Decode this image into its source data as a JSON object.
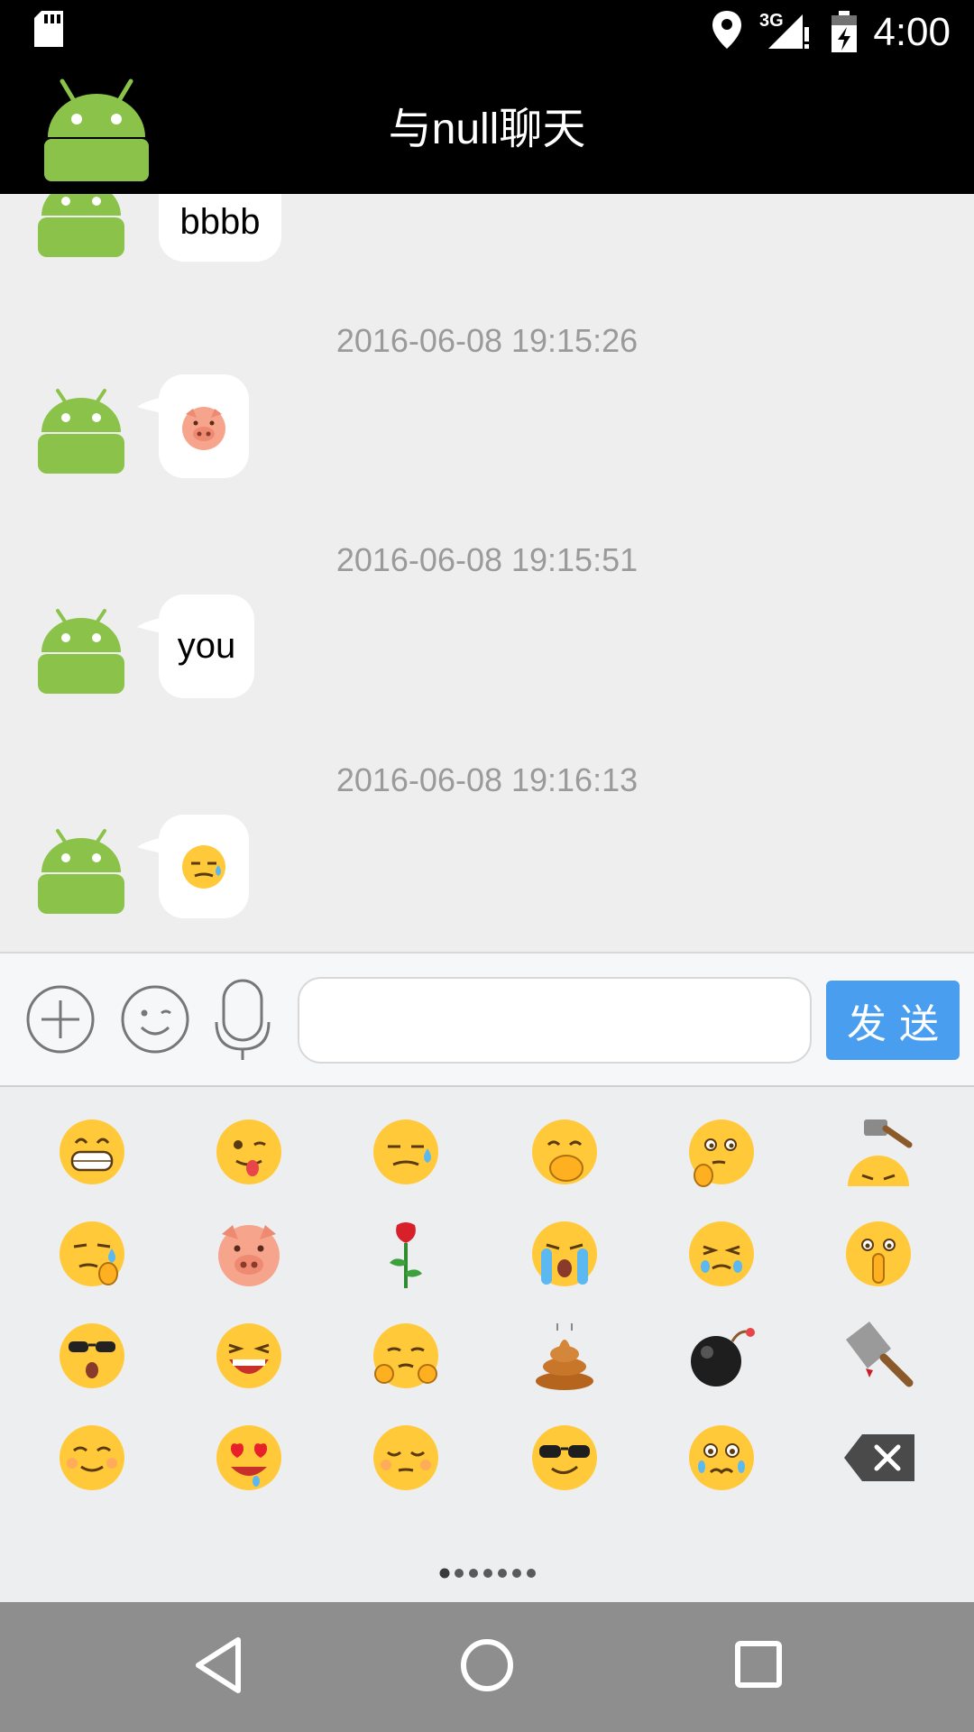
{
  "status_bar": {
    "time": "4:00",
    "network": "3G"
  },
  "app_bar": {
    "title": "与null聊天"
  },
  "messages": [
    {
      "timestamp": "",
      "type": "text",
      "content": "bbbb"
    },
    {
      "timestamp": "2016-06-08 19:15:26",
      "type": "emoji",
      "content": "pig-face"
    },
    {
      "timestamp": "2016-06-08 19:15:51",
      "type": "text",
      "content": "you"
    },
    {
      "timestamp": "2016-06-08 19:16:13",
      "type": "emoji",
      "content": "sweat-face"
    }
  ],
  "input_bar": {
    "message_value": "",
    "send_label": "发送"
  },
  "emoji_grid": [
    "grin",
    "tongue-wink",
    "sweat-annoyed",
    "giggle",
    "thinking",
    "hammer-head",
    "wipe-sweat",
    "pig",
    "rose",
    "loud-crying",
    "shy-crying",
    "shush",
    "cool-surprised",
    "laughing",
    "sneaky",
    "poop",
    "bomb",
    "cleaver",
    "smile",
    "heart-eyes",
    "sleepy",
    "sunglasses",
    "worried-crying",
    "backspace"
  ],
  "pager": {
    "pages": 7,
    "current": 1
  },
  "colors": {
    "accent": "#4a9ef0",
    "android_green": "#8bc34a",
    "timestamp": "#9a9a9a"
  }
}
